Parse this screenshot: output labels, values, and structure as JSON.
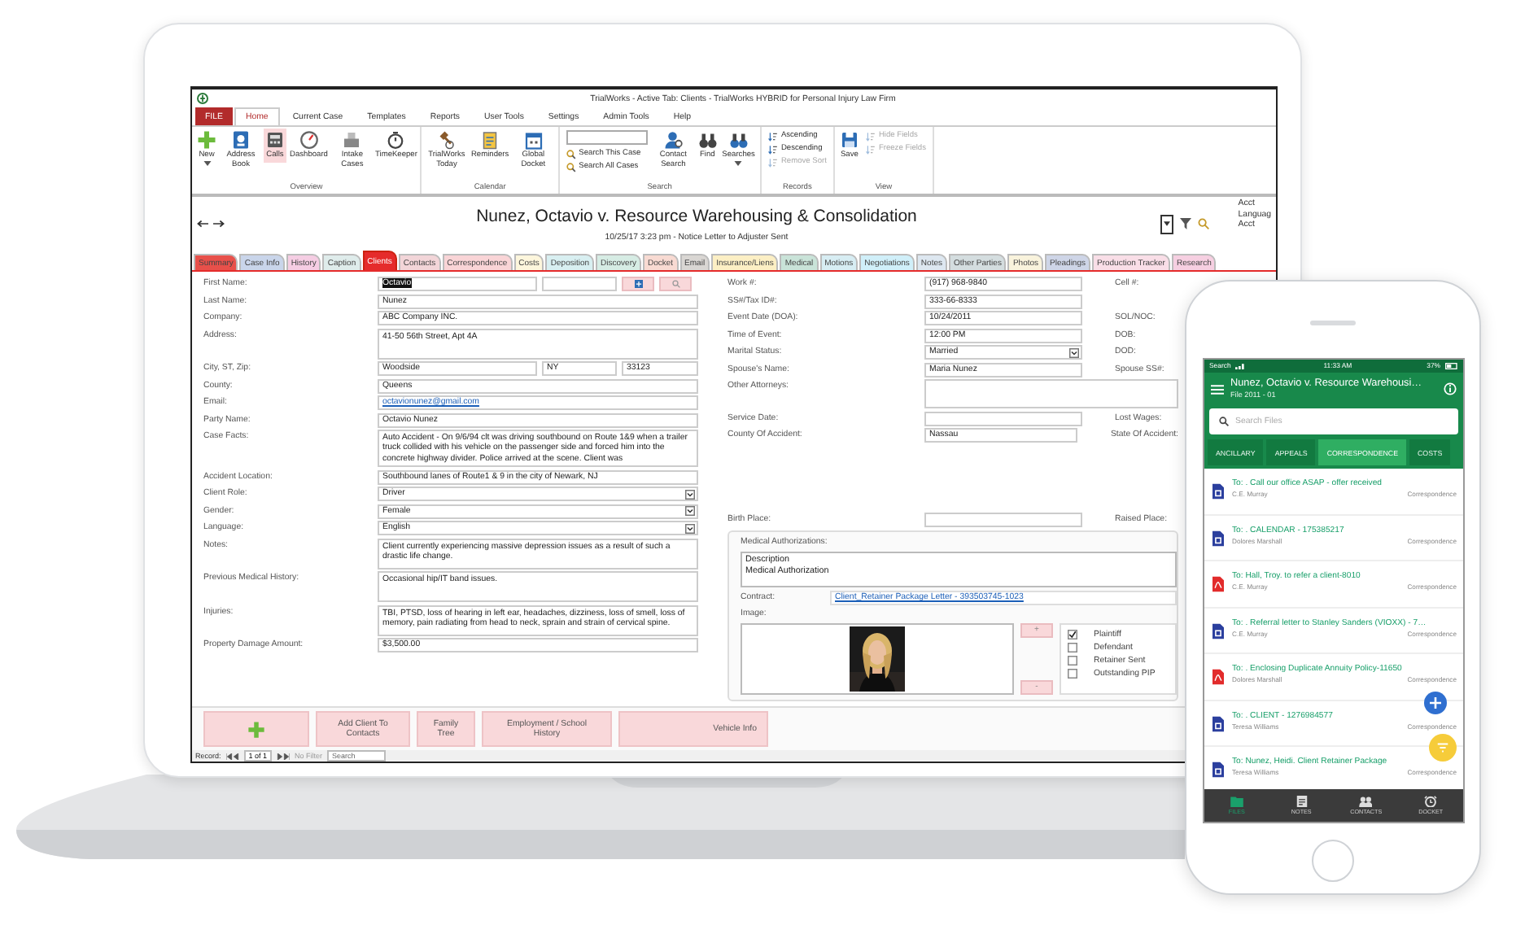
{
  "window": {
    "title": "TrialWorks - Active Tab: Clients - TrialWorks HYBRID for Personal Injury Law Firm"
  },
  "file_tab": "FILE",
  "ribbon_tabs": [
    {
      "label": "Home",
      "selected": true
    },
    {
      "label": "Current Case",
      "selected": false
    },
    {
      "label": "Templates",
      "selected": false
    },
    {
      "label": "Reports",
      "selected": false
    },
    {
      "label": "User Tools",
      "selected": false
    },
    {
      "label": "Settings",
      "selected": false
    },
    {
      "label": "Admin Tools",
      "selected": false
    },
    {
      "label": "Help",
      "selected": false
    }
  ],
  "ribbon_groups": [
    {
      "label": "Overview",
      "items": [
        {
          "kind": "large",
          "label": "New",
          "highlighted": false,
          "menu": true
        },
        {
          "kind": "large",
          "label": "Address Book",
          "highlighted": false
        },
        {
          "kind": "large",
          "label": "Calls",
          "highlighted": true
        },
        {
          "kind": "large",
          "label": "Dashboard",
          "highlighted": false
        },
        {
          "kind": "large",
          "label": "Intake Cases",
          "highlighted": false
        },
        {
          "kind": "large",
          "label": "TimeKeeper",
          "highlighted": false
        }
      ]
    },
    {
      "label": "Calendar",
      "items": [
        {
          "kind": "large",
          "label": "TrialWorks Today",
          "highlighted": false
        },
        {
          "kind": "large",
          "label": "Reminders",
          "highlighted": false
        },
        {
          "kind": "large",
          "label": "Global Docket",
          "highlighted": false
        }
      ]
    },
    {
      "label": "Search",
      "items": [
        {
          "kind": "search_stack",
          "entries": [
            {
              "label": "Search This Case",
              "disabled": false
            },
            {
              "label": "Search All Cases",
              "disabled": false
            }
          ]
        },
        {
          "kind": "large",
          "label": "Contact Search",
          "highlighted": false
        },
        {
          "kind": "large",
          "label": "Find",
          "highlighted": false
        },
        {
          "kind": "large",
          "label": "Searches",
          "highlighted": false,
          "menu": true
        }
      ]
    },
    {
      "label": "Records",
      "items": [
        {
          "kind": "stack",
          "entries": [
            {
              "label": "Ascending",
              "disabled": false
            },
            {
              "label": "Descending",
              "disabled": false
            },
            {
              "label": "Remove Sort",
              "disabled": true
            }
          ]
        }
      ]
    },
    {
      "label": "View",
      "items": [
        {
          "kind": "large",
          "label": "Save",
          "highlighted": false
        },
        {
          "kind": "stack",
          "entries": [
            {
              "label": "Hide Fields",
              "disabled": true
            },
            {
              "label": "Freeze Fields",
              "disabled": true
            }
          ]
        }
      ]
    }
  ],
  "case_header": {
    "title": "Nunez, Octavio v. Resource Warehousing & Consolidation",
    "subtitle": "10/25/17  3:23 pm - Notice Letter to Adjuster Sent",
    "side_texts": [
      "Acct",
      "Languag",
      "Acct"
    ]
  },
  "case_tabs": [
    {
      "label": "Summary",
      "color": "#e8504a",
      "selected": false
    },
    {
      "label": "Case Info",
      "color": "#c9d5ea",
      "selected": false
    },
    {
      "label": "History",
      "color": "#f5cde3",
      "selected": false
    },
    {
      "label": "Caption",
      "color": "#dfeceb",
      "selected": false
    },
    {
      "label": "Clients",
      "color": "#e52b2b",
      "selected": true
    },
    {
      "label": "Contacts",
      "color": "#f2d5d8",
      "selected": false
    },
    {
      "label": "Correspondence",
      "color": "#f9d4d6",
      "selected": false
    },
    {
      "label": "Costs",
      "color": "#fdf6dc",
      "selected": false
    },
    {
      "label": "Deposition",
      "color": "#d8eff1",
      "selected": false
    },
    {
      "label": "Discovery",
      "color": "#d6ece4",
      "selected": false
    },
    {
      "label": "Docket",
      "color": "#f8dad2",
      "selected": false
    },
    {
      "label": "Email",
      "color": "#d9d6d3",
      "selected": false
    },
    {
      "label": "Insurance/Liens",
      "color": "#fcefc4",
      "selected": false
    },
    {
      "label": "Medical",
      "color": "#c9e3d8",
      "selected": false
    },
    {
      "label": "Motions",
      "color": "#d7edf3",
      "selected": false
    },
    {
      "label": "Negotiations",
      "color": "#d0eff9",
      "selected": false
    },
    {
      "label": "Notes",
      "color": "#dde7f0",
      "selected": false
    },
    {
      "label": "Other Parties",
      "color": "#d4dddf",
      "selected": false
    },
    {
      "label": "Photos",
      "color": "#f9f3dc",
      "selected": false
    },
    {
      "label": "Pleadings",
      "color": "#ced5e7",
      "selected": false
    },
    {
      "label": "Production Tracker",
      "color": "#f9dee7",
      "selected": false
    },
    {
      "label": "Research",
      "color": "#f6cfe1",
      "selected": false
    }
  ],
  "form": {
    "left": [
      {
        "label": "First Name:",
        "kind": "name",
        "fields": [
          {
            "value": "Octavio",
            "selected": true
          },
          {
            "selected": false
          }
        ]
      },
      {
        "label": "Last Name:",
        "kind": "text",
        "value": "Nunez"
      },
      {
        "label": "Company:",
        "kind": "text",
        "value": "ABC Company INC."
      },
      {
        "label": "Address:",
        "kind": "area",
        "value": "41-50 56th Street, Apt 4A"
      },
      {
        "label": "City, ST, Zip:",
        "kind": "city",
        "fields": [
          {
            "value": "Woodside"
          },
          {
            "value": "NY"
          },
          {
            "value": "33123"
          }
        ]
      },
      {
        "label": "County:",
        "kind": "text",
        "value": "Queens"
      },
      {
        "label": "Email:",
        "kind": "link",
        "value": "octavionunez@gmail.com"
      },
      {
        "label": "Party Name:",
        "kind": "text",
        "value": "Octavio Nunez"
      },
      {
        "label": "Case Facts:",
        "kind": "area",
        "value": "Auto Accident - On 9/6/94 clt was driving southbound on Route 1&9 when a trailer truck collided with his vehicle on the passenger side and forced him into the concrete highway divider. Police arrived at the scene. Client was"
      },
      {
        "label": "Accident Location:",
        "kind": "text",
        "value": "Southbound lanes of Route1 & 9 in the city of Newark, NJ"
      },
      {
        "label": "Client Role:",
        "kind": "dropdown",
        "value": "Driver"
      },
      {
        "label": "Gender:",
        "kind": "dropdown",
        "value": "Female"
      },
      {
        "label": "Language:",
        "kind": "dropdown",
        "value": "English"
      },
      {
        "label": "Notes:",
        "kind": "area",
        "value": "Client currently experiencing massive depression issues as a result of such a drastic life change."
      },
      {
        "label": "Previous Medical History:",
        "kind": "area",
        "value": "Occasional hip/IT band issues."
      },
      {
        "label": "Injuries:",
        "kind": "area",
        "value": "TBI, PTSD, loss of hearing in left ear, headaches, dizziness, loss of smell, loss of memory, pain radiating from head to neck, sprain and strain of cervical spine."
      },
      {
        "label": "Property Damage Amount:",
        "kind": "text",
        "value": "$3,500.00"
      }
    ],
    "middle": [
      {
        "label": "Work #:",
        "kind": "text",
        "value": "(917) 968-9840",
        "side": "Cell #:"
      },
      {
        "label": "SS#/Tax ID#:",
        "kind": "text",
        "value": "333-66-8333"
      },
      {
        "label": "Event Date (DOA):",
        "kind": "text",
        "value": "10/24/2011",
        "side": "SOL/NOC:"
      },
      {
        "label": "Time of Event:",
        "kind": "text",
        "value": "12:00 PM",
        "side": "DOB:"
      },
      {
        "label": "Marital Status:",
        "kind": "dropdown",
        "value": "Married",
        "side": "DOD:"
      },
      {
        "label": "Spouse's Name:",
        "kind": "text",
        "value": "Maria Nunez",
        "side": "Spouse SS#:"
      },
      {
        "label": "Other Attorneys:",
        "kind": "area"
      },
      {
        "label": "Service Date:",
        "kind": "text",
        "side": "Lost Wages:"
      },
      {
        "label": "County Of Accident:",
        "kind": "text",
        "value": "Nassau",
        "side": "State Of Accident:"
      }
    ],
    "lower": [
      {
        "label": "Birth Place:",
        "kind": "text",
        "side": "Raised Place:"
      }
    ],
    "medical": {
      "title": "Medical Authorizations:",
      "list_header": "Description",
      "list_items": [
        "Medical Authorization"
      ],
      "contract_label": "Contract:",
      "contract_link": "Client_Retainer Package Letter - 393503745-1023",
      "image_label": "Image:",
      "image": {
        "kind": "picture"
      },
      "image_buttons": [
        "+",
        "-"
      ],
      "roles": [
        {
          "label": "Plaintiff",
          "checked": true
        },
        {
          "label": "Defendant",
          "checked": false
        },
        {
          "label": "Retainer Sent",
          "checked": false
        },
        {
          "label": "Outstanding PIP",
          "checked": false
        }
      ]
    }
  },
  "bottom_buttons": [
    {
      "kind": "add"
    },
    {
      "kind": "text",
      "label": "Add Client To Contacts"
    },
    {
      "kind": "text",
      "label": "Family Tree"
    },
    {
      "kind": "text",
      "label": "Employment / School History"
    },
    {
      "kind": "text",
      "label": "Vehicle Info"
    }
  ],
  "record_bar": {
    "label": "Record:",
    "position": "1 of 1",
    "filter": "No Filter",
    "search": "Search"
  },
  "phone": {
    "status": {
      "carrier": "Search",
      "time": "11:33 AM",
      "battery": "37%"
    },
    "title": "Nunez, Octavio v. Resource Warehousi…",
    "subtitle": "File 2011 - 01",
    "search": {
      "placeholder": "Search Files"
    },
    "tabs": [
      {
        "label": "ANCILLARY",
        "selected": false
      },
      {
        "label": "APPEALS",
        "selected": false
      },
      {
        "label": "CORRESPONDENCE",
        "selected": true
      },
      {
        "label": "COSTS",
        "selected": false
      }
    ],
    "items": [
      {
        "kind": "doc",
        "title": "To: . Call our office ASAP - offer received",
        "person": "C.E. Murray",
        "category": "Correspondence"
      },
      {
        "kind": "doc",
        "title": "To: . CALENDAR - 175385217",
        "person": "Dolores Marshall",
        "category": "Correspondence"
      },
      {
        "kind": "pdf",
        "title": "To: Hall, Troy. to refer a client-8010",
        "person": "C.E. Murray",
        "category": "Correspondence"
      },
      {
        "kind": "doc",
        "title": "To: . Referral letter to Stanley Sanders (VIOXX) - 7…",
        "person": "C.E. Murray",
        "category": "Correspondence"
      },
      {
        "kind": "pdf",
        "title": "To: . Enclosing Duplicate Annuity Policy-11650",
        "person": "Dolores Marshall",
        "category": "Correspondence"
      },
      {
        "kind": "doc",
        "title": "To: . CLIENT - 1276984577",
        "person": "Teresa Williams",
        "category": "Correspondence"
      },
      {
        "kind": "doc",
        "title": "To: Nunez, Heidi. Client Retainer Package",
        "person": "Teresa Williams",
        "category": "Correspondence"
      }
    ],
    "nav": [
      {
        "label": "FILES",
        "selected": true
      },
      {
        "label": "NOTES",
        "selected": false
      },
      {
        "label": "CONTACTS",
        "selected": false
      },
      {
        "label": "DOCKET",
        "selected": false
      }
    ]
  }
}
